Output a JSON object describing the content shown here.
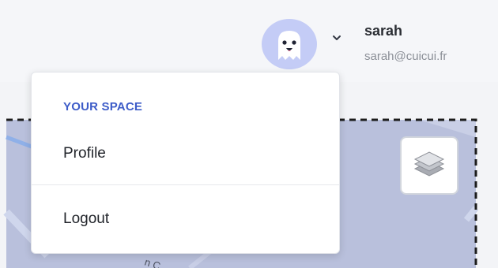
{
  "user": {
    "name": "sarah",
    "email": "sarah@cuicui.fr"
  },
  "dropdown": {
    "section_title": "YOUR SPACE",
    "items": [
      {
        "label": "Profile"
      },
      {
        "label": "Logout"
      }
    ]
  },
  "map": {
    "street_label_fragment": "n C"
  },
  "icons": {
    "avatar": "ghost-avatar-icon",
    "chevron": "chevron-down-icon",
    "layers": "layers-icon"
  },
  "colors": {
    "accent": "#3d5cc8",
    "avatar_bg": "#c4ccf6",
    "map_fill": "#b9c0dc",
    "road": "#8fb0e8"
  }
}
